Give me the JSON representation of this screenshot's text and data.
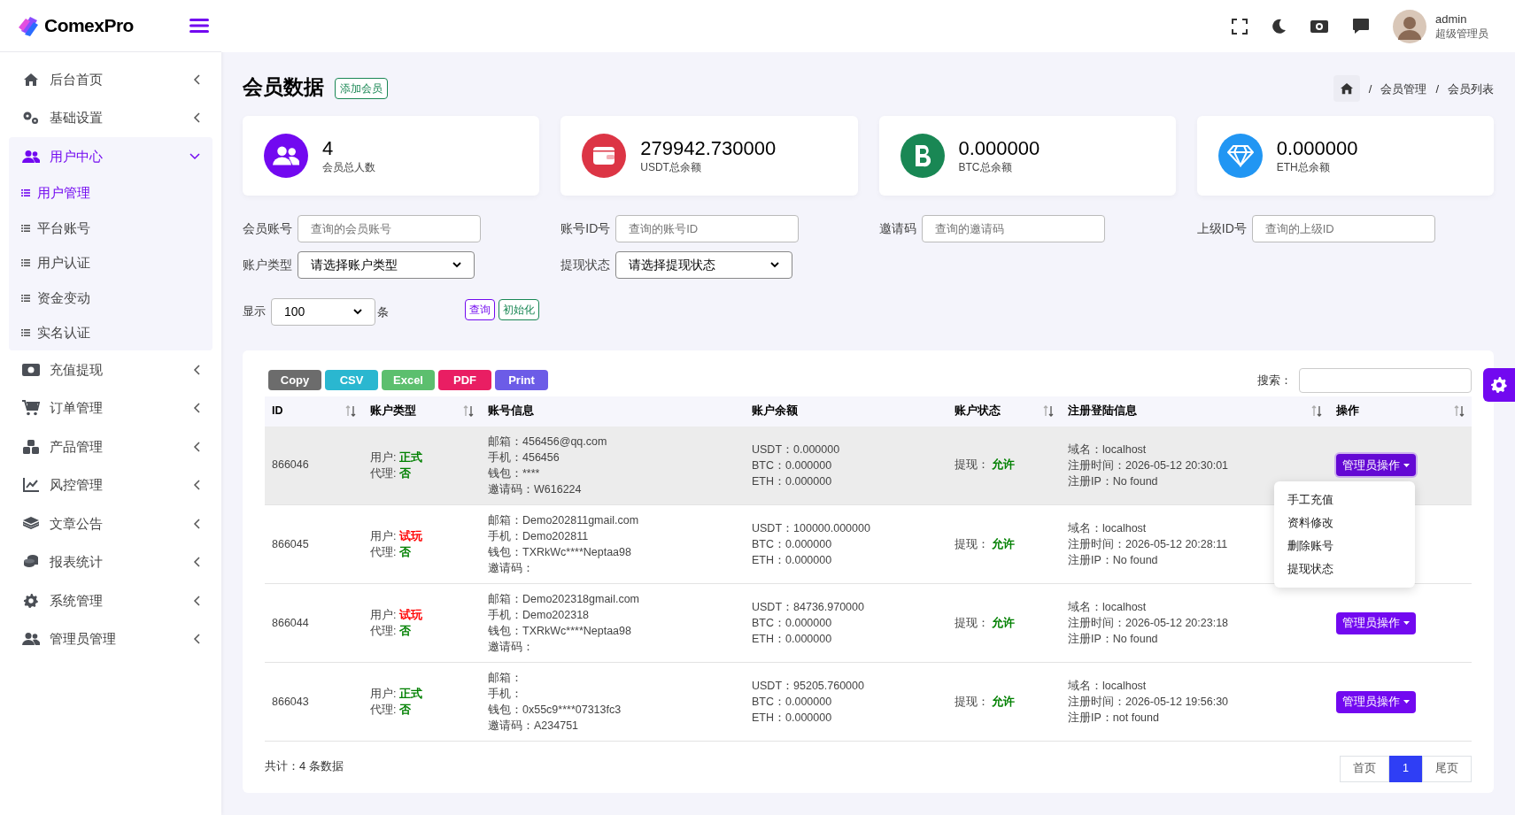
{
  "logo": {
    "text": "ComexPro"
  },
  "sidebar": {
    "items": [
      {
        "label": "后台首页",
        "expanded": false
      },
      {
        "label": "基础设置",
        "expanded": false
      },
      {
        "label": "用户中心",
        "expanded": true,
        "children": [
          {
            "label": "用户管理",
            "selected": true
          },
          {
            "label": "平台账号",
            "selected": false
          },
          {
            "label": "用户认证",
            "selected": false
          },
          {
            "label": "资金变动",
            "selected": false
          },
          {
            "label": "实名认证",
            "selected": false
          }
        ]
      },
      {
        "label": "充值提现",
        "expanded": false
      },
      {
        "label": "订单管理",
        "expanded": false
      },
      {
        "label": "产品管理",
        "expanded": false
      },
      {
        "label": "风控管理",
        "expanded": false
      },
      {
        "label": "文章公告",
        "expanded": false
      },
      {
        "label": "报表统计",
        "expanded": false
      },
      {
        "label": "系统管理",
        "expanded": false
      },
      {
        "label": "管理员管理",
        "expanded": false
      }
    ]
  },
  "user": {
    "name": "admin",
    "role": "超级管理员"
  },
  "page": {
    "title": "会员数据",
    "add_button": "添加会员",
    "breadcrumb": [
      {
        "separator": "/",
        "label": "会员管理"
      },
      {
        "separator": "/",
        "label": "会员列表"
      }
    ]
  },
  "stats": [
    {
      "value": "4",
      "label": "会员总人数",
      "kind": "users",
      "color": "#7209f0"
    },
    {
      "value": "279942.730000",
      "label": "USDT总余额",
      "kind": "wallet",
      "color": "#dc3545"
    },
    {
      "value": "0.000000",
      "label": "BTC总余额",
      "kind": "btc",
      "color": "#198754"
    },
    {
      "value": "0.000000",
      "label": "ETH总余额",
      "kind": "diamond",
      "color": "#2196f3"
    }
  ],
  "filters": [
    {
      "label": "会员账号",
      "kind": "input",
      "placeholder": "查询的会员账号"
    },
    {
      "label": "账号ID号",
      "kind": "input",
      "placeholder": "查询的账号ID"
    },
    {
      "label": "邀请码",
      "kind": "input",
      "placeholder": "查询的邀请码"
    },
    {
      "label": "上级ID号",
      "kind": "input",
      "placeholder": "查询的上级ID"
    },
    {
      "label": "账户类型",
      "kind": "select",
      "value": "请选择账户类型"
    },
    {
      "label": "提现状态",
      "kind": "select",
      "value": "请选择提现状态"
    }
  ],
  "page_size": {
    "label": "显示",
    "value": "100",
    "unit": "条"
  },
  "query_buttons": [
    {
      "label": "查询",
      "kind": "primary"
    },
    {
      "label": "初始化",
      "kind": "success"
    }
  ],
  "table": {
    "export_buttons": [
      {
        "label": "Copy",
        "color": "#6c6c6c"
      },
      {
        "label": "CSV",
        "color": "#2ab7d0"
      },
      {
        "label": "Excel",
        "color": "#5cbf6e"
      },
      {
        "label": "PDF",
        "color": "#e91e63"
      },
      {
        "label": "Print",
        "color": "#6c5ce7"
      }
    ],
    "search_label": "搜索：",
    "columns": [
      {
        "label": "ID",
        "sortable": true
      },
      {
        "label": "账户类型",
        "sortable": true
      },
      {
        "label": "账号信息",
        "sortable": false
      },
      {
        "label": "账户余额",
        "sortable": false
      },
      {
        "label": "账户状态",
        "sortable": true
      },
      {
        "label": "注册登陆信息",
        "sortable": true
      },
      {
        "label": "操作",
        "sortable": true
      }
    ],
    "rows": [
      {
        "id": "866046",
        "selected": true,
        "user_label": "用户:",
        "user_type": {
          "text": "正式",
          "color": "#008000"
        },
        "agent_label": "代理:",
        "agent": "否",
        "info": [
          "邮箱：456456@qq.com",
          "手机：456456",
          "钱包：****",
          "邀请码：W616224"
        ],
        "balances": [
          "USDT：0.000000",
          "BTC：0.000000",
          "ETH：0.000000"
        ],
        "status_label": "提现：",
        "status": "允许",
        "register": [
          "域名：localhost",
          "注册时间：2026-05-12 20:30:01",
          "注册IP：No found"
        ],
        "action": "管理员操作",
        "menu_open": true
      },
      {
        "id": "866045",
        "selected": false,
        "user_label": "用户:",
        "user_type": {
          "text": "试玩",
          "color": "#ff0000"
        },
        "agent_label": "代理:",
        "agent": "否",
        "info": [
          "邮箱：Demo202811gmail.com",
          "手机：Demo202811",
          "钱包：TXRkWc****Neptaa98",
          "邀请码："
        ],
        "balances": [
          "USDT：100000.000000",
          "BTC：0.000000",
          "ETH：0.000000"
        ],
        "status_label": "提现：",
        "status": "允许",
        "register": [
          "域名：localhost",
          "注册时间：2026-05-12 20:28:11",
          "注册IP：No found"
        ],
        "menu_open": false
      },
      {
        "id": "866044",
        "selected": false,
        "user_label": "用户:",
        "user_type": {
          "text": "试玩",
          "color": "#ff0000"
        },
        "agent_label": "代理:",
        "agent": "否",
        "info": [
          "邮箱：Demo202318gmail.com",
          "手机：Demo202318",
          "钱包：TXRkWc****Neptaa98",
          "邀请码："
        ],
        "balances": [
          "USDT：84736.970000",
          "BTC：0.000000",
          "ETH：0.000000"
        ],
        "status_label": "提现：",
        "status": "允许",
        "register": [
          "域名：localhost",
          "注册时间：2026-05-12 20:23:18",
          "注册IP：No found"
        ],
        "action": "管理员操作",
        "menu_open": false
      },
      {
        "id": "866043",
        "selected": false,
        "user_label": "用户:",
        "user_type": {
          "text": "正式",
          "color": "#008000"
        },
        "agent_label": "代理:",
        "agent": "否",
        "info": [
          "邮箱：",
          "手机：",
          "钱包：0x55c9****07313fc3",
          "邀请码：A234751"
        ],
        "balances": [
          "USDT：95205.760000",
          "BTC：0.000000",
          "ETH：0.000000"
        ],
        "status_label": "提现：",
        "status": "允许",
        "register": [
          "域名：localhost",
          "注册时间：2026-05-12 19:56:30",
          "注册IP：not found"
        ],
        "action": "管理员操作",
        "menu_open": false
      }
    ],
    "action_menu": [
      "手工充值",
      "资料修改",
      "删除账号",
      "提现状态"
    ],
    "total": "共计：4 条数据",
    "pagination": [
      {
        "label": "首页",
        "selected": false
      },
      {
        "label": "1",
        "selected": true
      },
      {
        "label": "尾页",
        "selected": false
      }
    ]
  }
}
